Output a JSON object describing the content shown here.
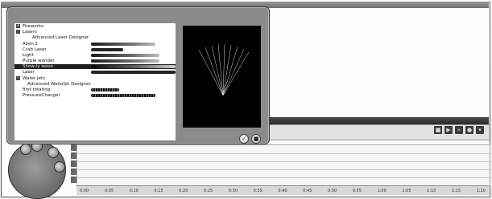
{
  "tree": {
    "categories": [
      {
        "label": "Fireworks",
        "expander": "+"
      },
      {
        "label": "Lasers",
        "expander": "-"
      },
      {
        "label": "Water Jets",
        "expander": "-"
      }
    ],
    "laser_designer": "Advanced Laser Designer",
    "laser_items": [
      "Alien 2",
      "Crab Laser",
      "Light",
      "Purple wonder",
      "Show-ly wave",
      "Laser"
    ],
    "waterjet_designer": "Advanced WaterJet Designer",
    "waterjet_items": [
      "first rotating",
      "PressureChanger"
    ]
  },
  "dialog": {
    "ok_label": "✓",
    "cancel_label": "■"
  },
  "timeline": {
    "ticks": [
      "0:00",
      "0:05",
      "0:10",
      "0:15",
      "0:20",
      "0:25",
      "0:30",
      "0:35",
      "0:40",
      "0:45",
      "0:50",
      "0:55",
      "1:00",
      "1:05",
      "1:10",
      "1:15",
      "1:20"
    ]
  },
  "colors": {
    "dialog_bg": "#8b8b8b",
    "preview_bg": "#000000",
    "laser_beam": "#ffffff"
  }
}
